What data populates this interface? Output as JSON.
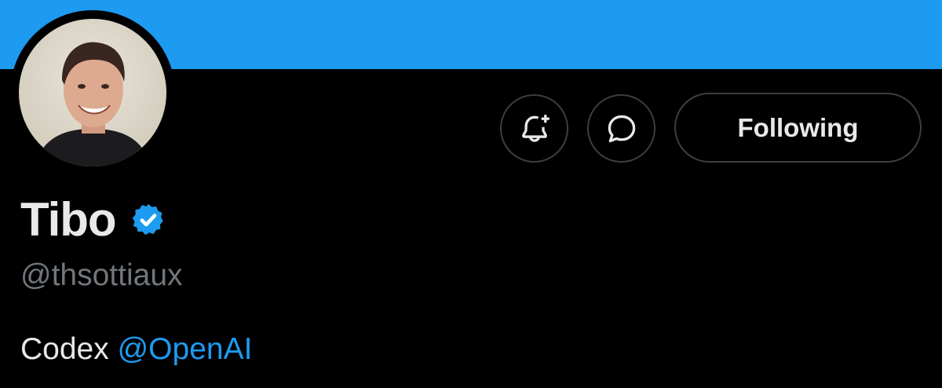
{
  "profile": {
    "display_name": "Tibo",
    "verified": true,
    "handle": "@thsottiaux",
    "bio_text": "Codex",
    "bio_mention": "@OpenAI"
  },
  "actions": {
    "follow_label": "Following"
  },
  "icons": {
    "notifications": "bell-plus-icon",
    "message": "chat-bubble-icon",
    "verified": "verified-badge-icon"
  },
  "colors": {
    "banner": "#1d9bf0",
    "background": "#000000",
    "accent": "#1d9bf0",
    "text_primary": "#e7e9ea",
    "text_secondary": "#71767b"
  }
}
